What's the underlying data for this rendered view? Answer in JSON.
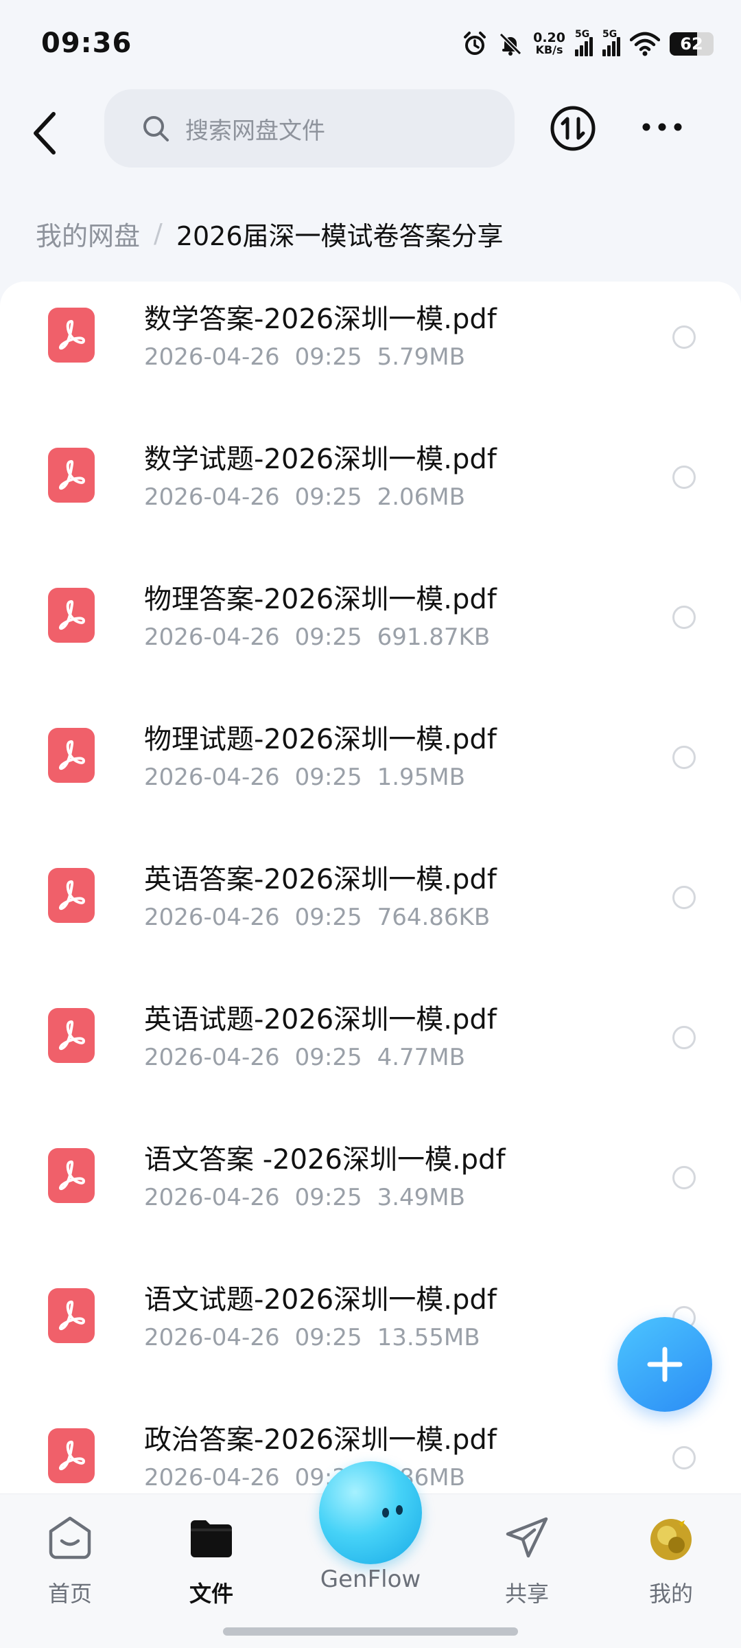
{
  "status_bar": {
    "time": "09:36",
    "net_speed_value": "0.20",
    "net_speed_unit": "KB/s",
    "signal1_label": "5G",
    "signal2_label": "5G",
    "battery": "62",
    "battery_level": 0.62
  },
  "top_bar": {
    "search_placeholder": "搜索网盘文件"
  },
  "breadcrumb": {
    "root": "我的网盘",
    "separator": "/",
    "current": "2026届深一模试卷答案分享"
  },
  "files": [
    {
      "name": "数学答案-2026深圳一模.pdf",
      "date": "2026-04-26",
      "time": "09:25",
      "size": "5.79MB"
    },
    {
      "name": "数学试题-2026深圳一模.pdf",
      "date": "2026-04-26",
      "time": "09:25",
      "size": "2.06MB"
    },
    {
      "name": "物理答案-2026深圳一模.pdf",
      "date": "2026-04-26",
      "time": "09:25",
      "size": "691.87KB"
    },
    {
      "name": "物理试题-2026深圳一模.pdf",
      "date": "2026-04-26",
      "time": "09:25",
      "size": "1.95MB"
    },
    {
      "name": "英语答案-2026深圳一模.pdf",
      "date": "2026-04-26",
      "time": "09:25",
      "size": "764.86KB"
    },
    {
      "name": "英语试题-2026深圳一模.pdf",
      "date": "2026-04-26",
      "time": "09:25",
      "size": "4.77MB"
    },
    {
      "name": "语文答案 -2026深圳一模.pdf",
      "date": "2026-04-26",
      "time": "09:25",
      "size": "3.49MB"
    },
    {
      "name": "语文试题-2026深圳一模.pdf",
      "date": "2026-04-26",
      "time": "09:25",
      "size": "13.55MB"
    },
    {
      "name": "政治答案-2026深圳一模.pdf",
      "date": "2026-04-26",
      "time": "09:25",
      "size": "3.86MB"
    }
  ],
  "bottom_nav": {
    "home": "首页",
    "files": "文件",
    "genflow": "GenFlow",
    "share": "共享",
    "mine": "我的"
  },
  "colors": {
    "accent": "#2b8cf5",
    "pdf_icon": "#f0606a"
  }
}
